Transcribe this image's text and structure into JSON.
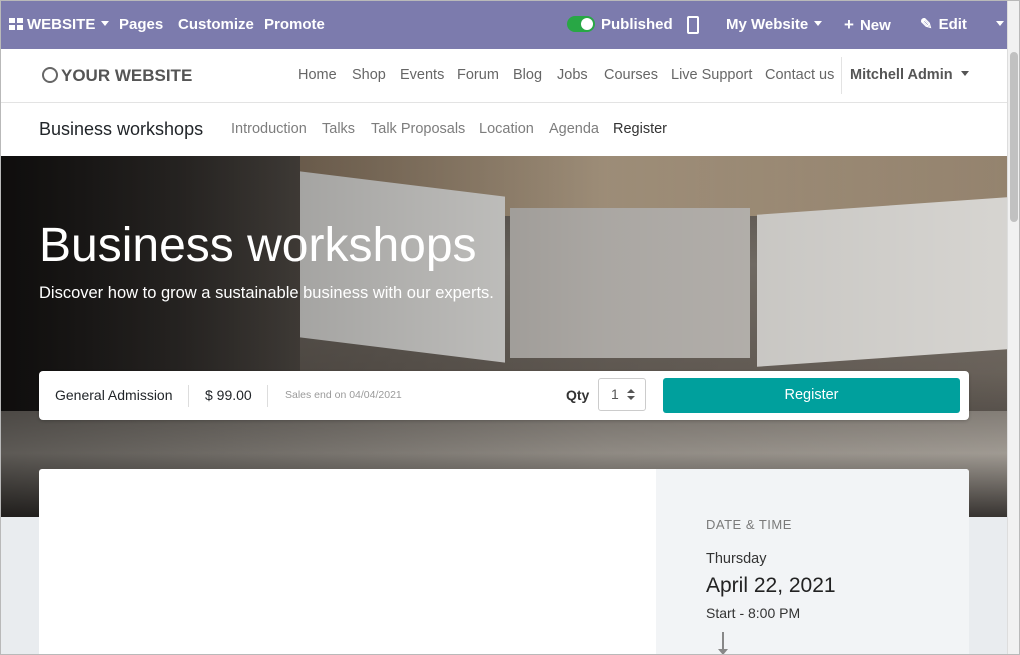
{
  "adminbar": {
    "app_menu": "WEBSITE",
    "pages": "Pages",
    "customize": "Customize",
    "promote": "Promote",
    "published": "Published",
    "website_selector": "My Website",
    "new": "New",
    "edit": "Edit"
  },
  "header": {
    "logo": "YOUR WEBSITE",
    "nav": [
      "Home",
      "Shop",
      "Events",
      "Forum",
      "Blog",
      "Jobs",
      "Courses",
      "Live Support",
      "Contact us"
    ],
    "user": "Mitchell Admin"
  },
  "event_nav": {
    "title": "Business workshops",
    "items": [
      "Introduction",
      "Talks",
      "Talk Proposals",
      "Location",
      "Agenda",
      "Register"
    ],
    "active": "Register"
  },
  "hero": {
    "title": "Business workshops",
    "subtitle": "Discover how to grow a sustainable business with our experts."
  },
  "ticket": {
    "name": "General Admission",
    "price": "$ 99.00",
    "sales_end": "Sales end on 04/04/2021",
    "qty_label": "Qty",
    "qty_value": "1",
    "register_button": "Register"
  },
  "sidebar": {
    "label": "DATE & TIME",
    "day": "Thursday",
    "date": "April 22, 2021",
    "start": "Start - 8:00 PM"
  },
  "colors": {
    "admin_bar": "#7c7bad",
    "primary_button": "#00a09d",
    "toggle_on": "#28a745"
  }
}
